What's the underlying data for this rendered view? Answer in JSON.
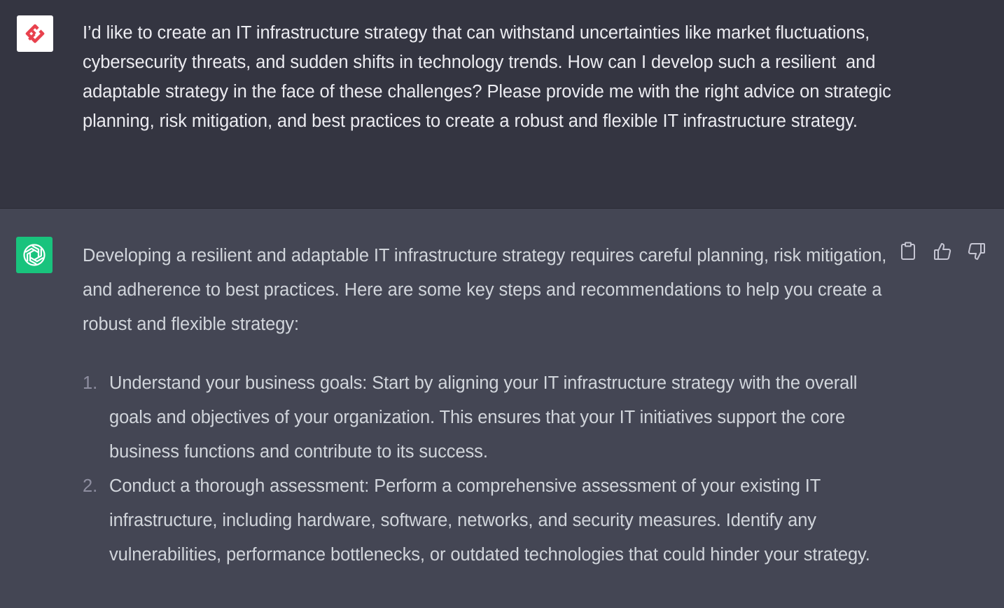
{
  "conversation": {
    "user_message": {
      "avatar_icon": "user-logo-icon",
      "text": "I’d like to create an IT infrastructure strategy that can withstand uncertainties like market fluctuations, cybersecurity threats, and sudden shifts in technology trends. How can I develop such a resilient  and adaptable strategy in the face of these challenges? Please provide me with the right advice on strategic planning, risk mitigation, and best practices to create a robust and flexible IT infrastructure strategy."
    },
    "assistant_message": {
      "avatar_icon": "openai-logo-icon",
      "intro": "Developing a resilient and adaptable IT infrastructure strategy requires careful planning, risk mitigation, and adherence to best practices. Here are some key steps and recommendations to help you create a robust and flexible strategy:",
      "items": [
        {
          "number": "1.",
          "text": "Understand your business goals: Start by aligning your IT infrastructure strategy with the overall goals and objectives of your organization. This ensures that your IT initiatives support the core business functions and contribute to its success."
        },
        {
          "number": "2.",
          "text": "Conduct a thorough assessment: Perform a comprehensive assessment of your existing IT infrastructure, including hardware, software, networks, and security measures. Identify any vulnerabilities, performance bottlenecks, or outdated technologies that could hinder your strategy."
        }
      ],
      "actions": [
        "copy-icon",
        "thumbs-up-icon",
        "thumbs-down-icon"
      ]
    }
  },
  "colors": {
    "user_bg": "#343541",
    "assistant_bg": "#444654",
    "bot_avatar": "#19c37d",
    "user_logo": "#e8414d"
  }
}
